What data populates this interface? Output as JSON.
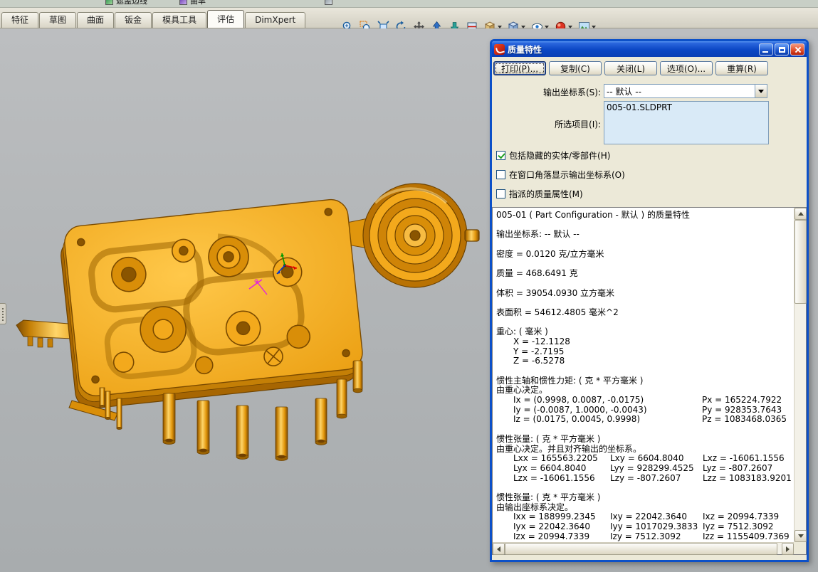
{
  "top_toolbar_fragment": {
    "items": [
      "遮盖边线",
      "曲率"
    ]
  },
  "tabs": {
    "items": [
      "特征",
      "草图",
      "曲面",
      "钣金",
      "模具工具",
      "评估",
      "DimXpert"
    ],
    "active": "评估"
  },
  "view_toolbar": {
    "buttons": [
      "zoom-in-out",
      "zoom-to-area",
      "zoom-to-fit",
      "rotate-view",
      "pan",
      "normal-to",
      "previous-view",
      "section-view",
      "view-orientation",
      "display-style",
      "hide-show-items",
      "edit-appearance",
      "apply-scene"
    ]
  },
  "dialog": {
    "title": "质量特性",
    "buttons": [
      "打印(P)...",
      "复制(C)",
      "关闭(L)",
      "选项(O)...",
      "重算(R)"
    ],
    "output_coord": {
      "label": "输出坐标系(S):",
      "value": "-- 默认 --"
    },
    "selected_items": {
      "label": "所选项目(I):",
      "value": "005-01.SLDPRT"
    },
    "checkboxes": [
      {
        "label": "包括隐藏的实体/零部件(H)",
        "checked": true
      },
      {
        "label": "在窗口角落显示输出坐标系(O)",
        "checked": false
      },
      {
        "label": "指派的质量属性(M)",
        "checked": false
      }
    ],
    "results": [
      {
        "cells": [
          "005-01 ( Part Configuration - 默认 ) 的质量特性"
        ],
        "style": ""
      },
      {
        "cells": [],
        "style": "blank"
      },
      {
        "cells": [
          "输出坐标系: -- 默认 --"
        ],
        "style": ""
      },
      {
        "cells": [],
        "style": "blank"
      },
      {
        "cells": [
          "密度 = 0.0120 克/立方毫米"
        ],
        "style": ""
      },
      {
        "cells": [],
        "style": "blank"
      },
      {
        "cells": [
          "质量 = 468.6491 克"
        ],
        "style": ""
      },
      {
        "cells": [],
        "style": "blank"
      },
      {
        "cells": [
          "体积 = 39054.0930 立方毫米"
        ],
        "style": ""
      },
      {
        "cells": [],
        "style": "blank"
      },
      {
        "cells": [
          "表面积 = 54612.4805 毫米^2"
        ],
        "style": ""
      },
      {
        "cells": [],
        "style": "blank"
      },
      {
        "cells": [
          "重心: ( 毫米 )"
        ],
        "style": ""
      },
      {
        "cells": [
          "X = -12.1128"
        ],
        "style": "ind"
      },
      {
        "cells": [
          "Y = -2.7195"
        ],
        "style": "ind"
      },
      {
        "cells": [
          "Z = -6.5278"
        ],
        "style": "ind"
      },
      {
        "cells": [],
        "style": "blank"
      },
      {
        "cells": [
          "惯性主轴和惯性力矩: ( 克 * 平方毫米 )"
        ],
        "style": ""
      },
      {
        "cells": [
          "由重心决定。"
        ],
        "style": ""
      },
      {
        "cells": [
          "Ix = (0.9998, 0.0087, -0.0175)",
          "Px = 165224.7922"
        ],
        "style": "r2"
      },
      {
        "cells": [
          "Iy = (-0.0087, 1.0000, -0.0043)",
          "Py = 928353.7643"
        ],
        "style": "r2"
      },
      {
        "cells": [
          "Iz = (0.0175, 0.0045, 0.9998)",
          "Pz = 1083468.0365"
        ],
        "style": "r2"
      },
      {
        "cells": [],
        "style": "blank"
      },
      {
        "cells": [
          "惯性张量: ( 克 * 平方毫米 )"
        ],
        "style": ""
      },
      {
        "cells": [
          "由重心决定。并且对齐输出的坐标系。"
        ],
        "style": ""
      },
      {
        "cells": [
          "Lxx = 165563.2205",
          "Lxy = 6604.8040",
          "Lxz = -16061.1556"
        ],
        "style": "r3"
      },
      {
        "cells": [
          "Lyx = 6604.8040",
          "Lyy = 928299.4525",
          "Lyz = -807.2607"
        ],
        "style": "r3"
      },
      {
        "cells": [
          "Lzx = -16061.1556",
          "Lzy = -807.2607",
          "Lzz = 1083183.9201"
        ],
        "style": "r3"
      },
      {
        "cells": [],
        "style": "blank"
      },
      {
        "cells": [
          "惯性张量: ( 克 * 平方毫米 )"
        ],
        "style": ""
      },
      {
        "cells": [
          "由输出座标系决定。"
        ],
        "style": ""
      },
      {
        "cells": [
          "Ixx = 188999.2345",
          "Ixy = 22042.3640",
          "Ixz = 20994.7339"
        ],
        "style": "r3"
      },
      {
        "cells": [
          "Iyx = 22042.3640",
          "Iyy = 1017029.3833",
          "Iyz = 7512.3092"
        ],
        "style": "r3"
      },
      {
        "cells": [
          "Izx = 20994.7339",
          "Izy = 7512.3092",
          "Izz = 1155409.7369"
        ],
        "style": "r3"
      }
    ]
  }
}
